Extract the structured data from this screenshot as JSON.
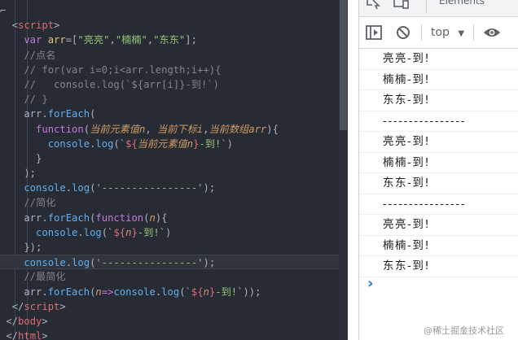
{
  "editor": {
    "lines": [
      {
        "parts": [
          [
            "c-pn",
            "⌐"
          ]
        ]
      },
      {
        "parts": [
          [
            "c-pn",
            "  <"
          ],
          [
            "c-tag",
            "script"
          ],
          [
            "c-pn",
            ">"
          ]
        ]
      },
      {
        "parts": [
          [
            "c-kw",
            "    var "
          ],
          [
            "c-var",
            "arr"
          ],
          [
            "c-pn",
            "=["
          ],
          [
            "c-str",
            "\"亮亮\""
          ],
          [
            "c-pn",
            ","
          ],
          [
            "c-str",
            "\"楠楠\""
          ],
          [
            "c-pn",
            ","
          ],
          [
            "c-str",
            "\"东东\""
          ],
          [
            "c-pn",
            "];"
          ]
        ]
      },
      {
        "parts": [
          [
            "c-com",
            "    //点名"
          ]
        ]
      },
      {
        "parts": [
          [
            "c-com",
            "    // for(var i=0;i<arr.length;i++){"
          ]
        ]
      },
      {
        "parts": [
          [
            "c-com",
            "    //   console.log(`${arr[i]}-到!`)"
          ]
        ]
      },
      {
        "parts": [
          [
            "c-com",
            "    // }"
          ]
        ]
      },
      {
        "parts": [
          [
            "c-pn",
            "    arr."
          ],
          [
            "c-fn",
            "forEach"
          ],
          [
            "c-pn",
            "("
          ]
        ]
      },
      {
        "parts": [
          [
            "c-kw",
            "      function"
          ],
          [
            "c-pn",
            "("
          ],
          [
            "c-pm",
            "当前元素值n"
          ],
          [
            "c-pn",
            ", "
          ],
          [
            "c-pm",
            "当前下标i"
          ],
          [
            "c-pn",
            ","
          ],
          [
            "c-pm",
            "当前数组arr"
          ],
          [
            "c-pn",
            "){"
          ]
        ]
      },
      {
        "parts": [
          [
            "c-fn",
            "        console"
          ],
          [
            "c-pn",
            "."
          ],
          [
            "c-fn",
            "log"
          ],
          [
            "c-pn",
            "(`"
          ],
          [
            "c-tpl",
            "${"
          ],
          [
            "c-pm",
            "当前元素值n"
          ],
          [
            "c-tpl",
            "}"
          ],
          [
            "c-str",
            "-到!"
          ],
          [
            "c-pn",
            "`)"
          ]
        ]
      },
      {
        "parts": [
          [
            "c-pn",
            "      }"
          ]
        ]
      },
      {
        "parts": [
          [
            "c-pn",
            "    );"
          ]
        ]
      },
      {
        "parts": [
          [
            "c-fn",
            "    console"
          ],
          [
            "c-pn",
            "."
          ],
          [
            "c-fn",
            "log"
          ],
          [
            "c-pn",
            "("
          ],
          [
            "c-str",
            "'----------------'"
          ],
          [
            "c-pn",
            ");"
          ]
        ]
      },
      {
        "parts": [
          [
            "c-com",
            "    //简化"
          ]
        ]
      },
      {
        "parts": [
          [
            "c-pn",
            "    arr."
          ],
          [
            "c-fn",
            "forEach"
          ],
          [
            "c-pn",
            "("
          ],
          [
            "c-kw",
            "function"
          ],
          [
            "c-pn",
            "("
          ],
          [
            "c-pm",
            "n"
          ],
          [
            "c-pn",
            "){"
          ]
        ]
      },
      {
        "parts": [
          [
            "c-fn",
            "      console"
          ],
          [
            "c-pn",
            "."
          ],
          [
            "c-fn",
            "log"
          ],
          [
            "c-pn",
            "(`"
          ],
          [
            "c-tpl",
            "${"
          ],
          [
            "c-pm",
            "n"
          ],
          [
            "c-tpl",
            "}"
          ],
          [
            "c-str",
            "-到!"
          ],
          [
            "c-pn",
            "`)"
          ]
        ]
      },
      {
        "parts": [
          [
            "c-pn",
            "    });"
          ]
        ]
      },
      {
        "parts": [
          [
            "c-fn",
            "    console"
          ],
          [
            "c-pn",
            "."
          ],
          [
            "c-fn",
            "log"
          ],
          [
            "c-pn",
            "("
          ],
          [
            "c-str",
            "'----------------'"
          ],
          [
            "c-pn",
            ");"
          ]
        ],
        "hl": true
      },
      {
        "parts": [
          [
            "c-com",
            "    //最简化"
          ]
        ]
      },
      {
        "parts": [
          [
            "c-pn",
            "    arr."
          ],
          [
            "c-fn",
            "forEach"
          ],
          [
            "c-pn",
            "("
          ],
          [
            "c-pm",
            "n"
          ],
          [
            "c-kw",
            "=>"
          ],
          [
            "c-fn",
            "console"
          ],
          [
            "c-pn",
            "."
          ],
          [
            "c-fn",
            "log"
          ],
          [
            "c-pn",
            "(`"
          ],
          [
            "c-tpl",
            "${"
          ],
          [
            "c-pm",
            "n"
          ],
          [
            "c-tpl",
            "}"
          ],
          [
            "c-str",
            "-到!"
          ],
          [
            "c-pn",
            "`));"
          ]
        ]
      },
      {
        "parts": [
          [
            "c-pn",
            "  </"
          ],
          [
            "c-tag",
            "script"
          ],
          [
            "c-pn",
            ">"
          ]
        ]
      },
      {
        "parts": [
          [
            "c-pn",
            " </"
          ],
          [
            "c-tag",
            "body"
          ],
          [
            "c-pn",
            ">"
          ]
        ]
      },
      {
        "parts": [
          [
            "c-pn",
            " </"
          ],
          [
            "c-tag",
            "html"
          ],
          [
            "c-pn",
            ">"
          ]
        ]
      }
    ]
  },
  "devtools": {
    "panel_tab": "Elements",
    "context": "top",
    "messages": [
      "亮亮-到!",
      "楠楠-到!",
      "东东-到!",
      "----------------",
      "亮亮-到!",
      "楠楠-到!",
      "东东-到!",
      "----------------",
      "亮亮-到!",
      "楠楠-到!",
      "东东-到!"
    ],
    "prompt": "›"
  },
  "watermark": "@稀土掘金技术社区",
  "colors": {
    "editor_bg": "#272b33",
    "accent_blue": "#1a73e8"
  }
}
